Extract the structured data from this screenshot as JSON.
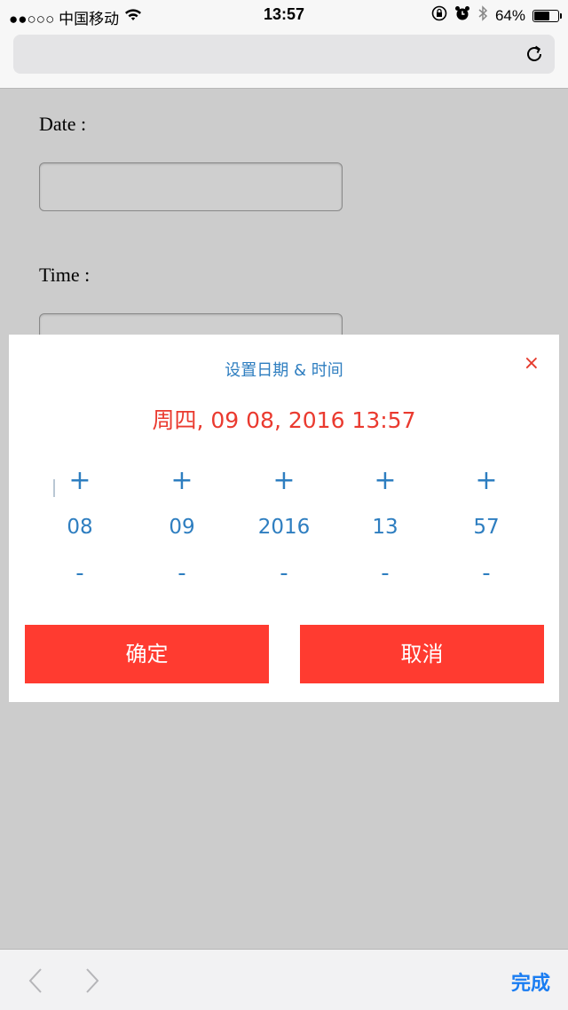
{
  "status_bar": {
    "carrier": "●●○○○ 中国移动",
    "time": "13:57",
    "battery_percent": "64%",
    "battery_level": 0.64,
    "icons": [
      "wifi-icon",
      "lock-rotation-icon",
      "alarm-icon",
      "bluetooth-icon",
      "battery-icon"
    ]
  },
  "browser": {
    "address": "",
    "reload_icon": "reload-icon"
  },
  "form": {
    "date_label": "Date :",
    "date_value": "",
    "time_label": "Time :",
    "time_value": ""
  },
  "picker": {
    "title": "设置日期 & 时间",
    "close": "×",
    "current": "周四, 09 08, 2016 13:57",
    "columns": [
      {
        "plus": "+",
        "value": "08",
        "minus": "-"
      },
      {
        "plus": "+",
        "value": "09",
        "minus": "-"
      },
      {
        "plus": "+",
        "value": "2016",
        "minus": "-"
      },
      {
        "plus": "+",
        "value": "13",
        "minus": "-"
      },
      {
        "plus": "+",
        "value": "57",
        "minus": "-"
      }
    ],
    "confirm": "确定",
    "cancel": "取消"
  },
  "toolbar": {
    "back_icon": "chevron-left-icon",
    "forward_icon": "chevron-right-icon",
    "done": "完成"
  },
  "colors": {
    "accent_blue": "#2e7ec0",
    "accent_red": "#ff3b30",
    "ios_blue": "#1a7df2"
  }
}
